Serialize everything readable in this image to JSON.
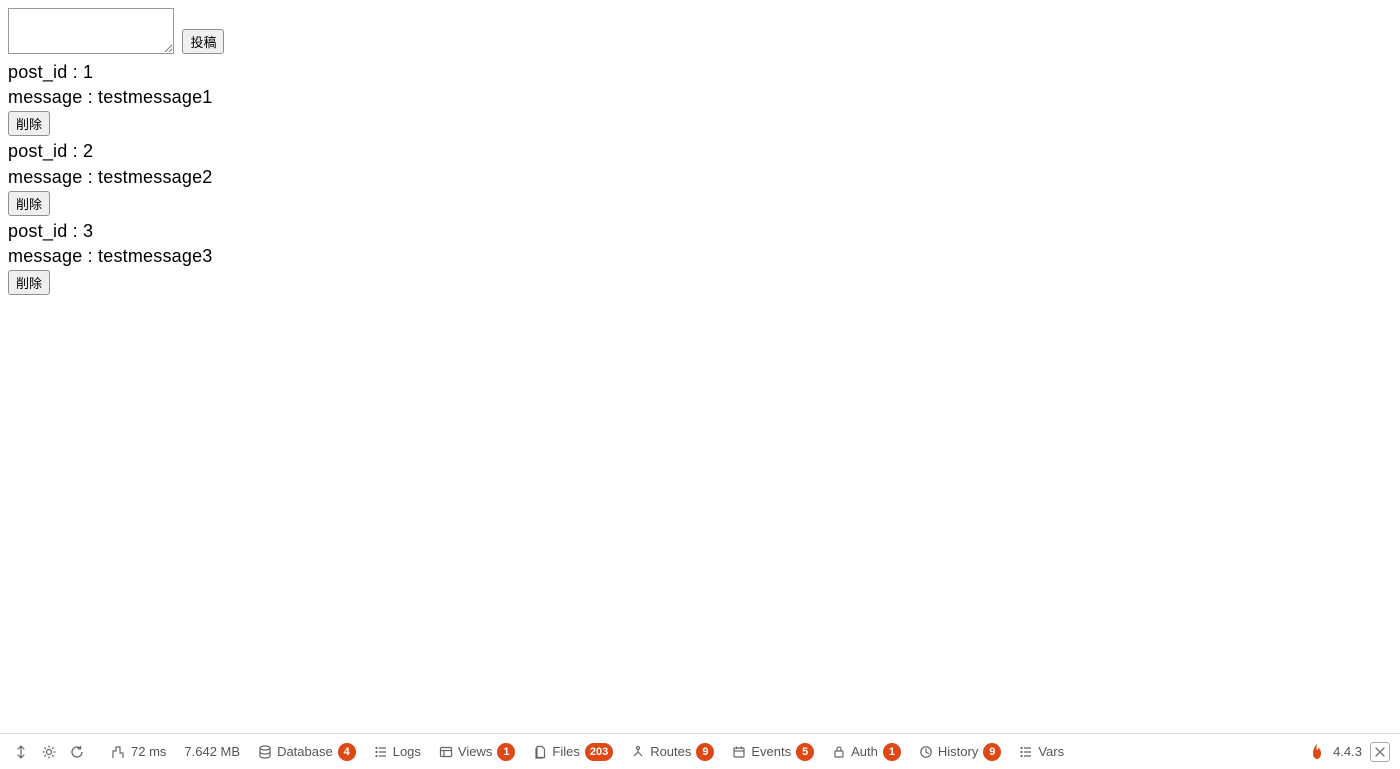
{
  "form": {
    "textarea_value": "",
    "submit_label": "投稿"
  },
  "labels": {
    "post_id_prefix": "post_id : ",
    "message_prefix": "message : ",
    "delete_label": "削除"
  },
  "posts": [
    {
      "post_id": "1",
      "message": "testmessage1"
    },
    {
      "post_id": "2",
      "message": "testmessage2"
    },
    {
      "post_id": "3",
      "message": "testmessage3"
    }
  ],
  "debug": {
    "time": "72 ms",
    "memory": "7.642 MB",
    "tabs": {
      "database": {
        "label": "Database",
        "badge": "4"
      },
      "logs": {
        "label": "Logs"
      },
      "views": {
        "label": "Views",
        "badge": "1"
      },
      "files": {
        "label": "Files",
        "badge": "203"
      },
      "routes": {
        "label": "Routes",
        "badge": "9"
      },
      "events": {
        "label": "Events",
        "badge": "5"
      },
      "auth": {
        "label": "Auth",
        "badge": "1"
      },
      "history": {
        "label": "History",
        "badge": "9"
      },
      "vars": {
        "label": "Vars"
      }
    },
    "version": "4.4.3"
  }
}
